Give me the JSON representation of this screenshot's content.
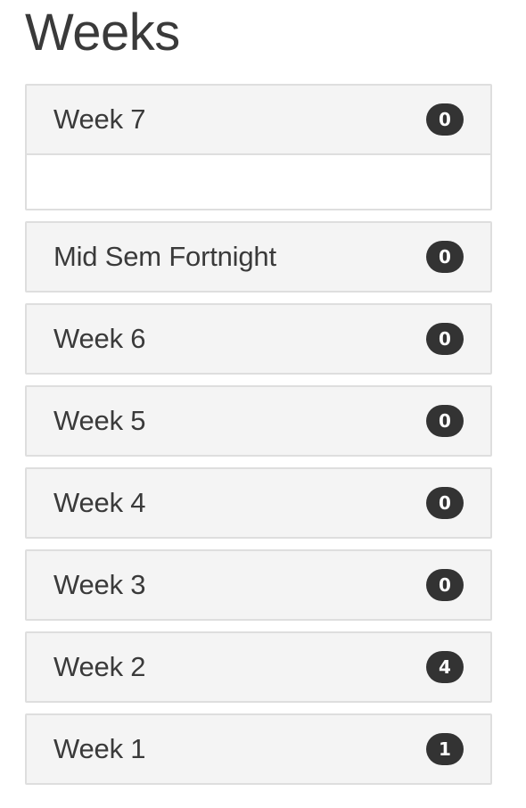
{
  "page": {
    "title": "Weeks"
  },
  "weeks": [
    {
      "label": "Week 7",
      "count": "0",
      "expanded": true
    },
    {
      "label": "Mid Sem Fortnight",
      "count": "0",
      "expanded": false
    },
    {
      "label": "Week 6",
      "count": "0",
      "expanded": false
    },
    {
      "label": "Week 5",
      "count": "0",
      "expanded": false
    },
    {
      "label": "Week 4",
      "count": "0",
      "expanded": false
    },
    {
      "label": "Week 3",
      "count": "0",
      "expanded": false
    },
    {
      "label": "Week 2",
      "count": "4",
      "expanded": false
    },
    {
      "label": "Week 1",
      "count": "1",
      "expanded": false
    }
  ],
  "colors": {
    "panel_background": "#f4f4f4",
    "panel_border": "#dedede",
    "badge_background": "#333333",
    "badge_text": "#ffffff",
    "text": "#3a3a3a"
  }
}
